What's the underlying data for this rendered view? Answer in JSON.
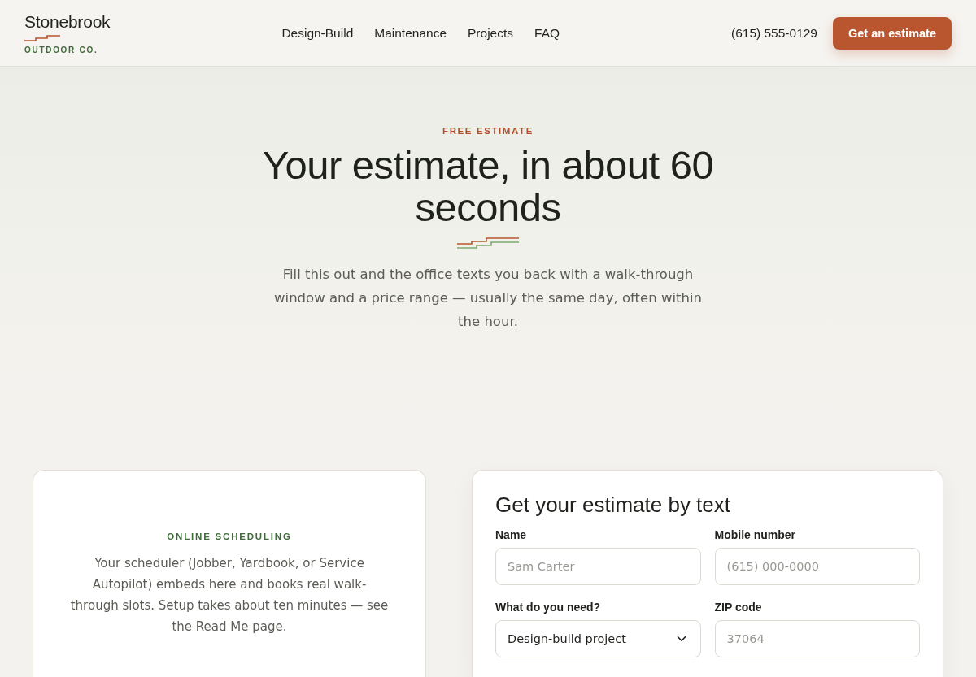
{
  "header": {
    "logo": {
      "name": "Stonebrook",
      "tagline": "OUTDOOR CO."
    },
    "nav": [
      {
        "label": "Design-Build"
      },
      {
        "label": "Maintenance"
      },
      {
        "label": "Projects"
      },
      {
        "label": "FAQ"
      }
    ],
    "phone": "(615) 555-0129",
    "cta": "Get an estimate"
  },
  "hero": {
    "eyebrow": "FREE ESTIMATE",
    "title": "Your estimate, in about 60 seconds",
    "lede": "Fill this out and the office texts you back with a walk-through window and a price range — usually the same day, often within the hour."
  },
  "scheduler": {
    "eyebrow": "ONLINE SCHEDULING",
    "text": "Your scheduler (Jobber, Yardbook, or Service Autopilot) embeds here and books real walk-through slots. Setup takes about ten minutes — see the Read Me page."
  },
  "form": {
    "title": "Get your estimate by text",
    "fields": [
      {
        "kind": "text",
        "label": "Name",
        "placeholder": "Sam Carter"
      },
      {
        "kind": "text",
        "label": "Mobile number",
        "placeholder": "(615) 000-0000"
      },
      {
        "kind": "select",
        "label": "What do you need?",
        "value": "Design-build project"
      },
      {
        "kind": "text",
        "label": "ZIP code",
        "placeholder": "37064"
      }
    ]
  }
}
